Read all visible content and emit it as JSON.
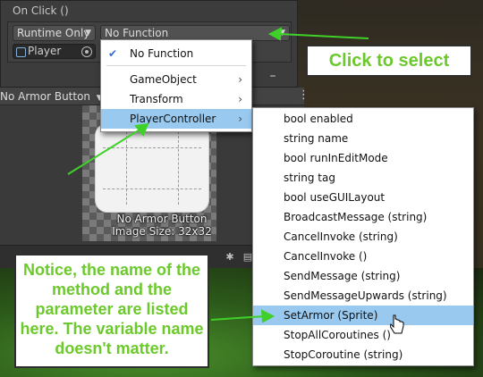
{
  "panel": {
    "title": "On Click ()",
    "runtime_select": "Runtime Only",
    "function_select": "No Function",
    "object_field": "Player",
    "remove_label": "–"
  },
  "preview": {
    "dropdown_label": "No Armor Button",
    "sprite_name": "No Armor Button",
    "image_size": "Image Size: 32x32"
  },
  "menu_primary": {
    "items": [
      {
        "label": "No Function",
        "checked": true
      },
      {
        "label": "GameObject",
        "submenu": true
      },
      {
        "label": "Transform",
        "submenu": true
      },
      {
        "label": "PlayerController",
        "submenu": true,
        "highlighted": true
      }
    ]
  },
  "menu_methods": {
    "items": [
      {
        "label": "bool enabled"
      },
      {
        "label": "string name"
      },
      {
        "label": "bool runInEditMode"
      },
      {
        "label": "string tag"
      },
      {
        "label": "bool useGUILayout"
      },
      {
        "label": "BroadcastMessage (string)"
      },
      {
        "label": "CancelInvoke (string)"
      },
      {
        "label": "CancelInvoke ()"
      },
      {
        "label": "SendMessage (string)"
      },
      {
        "label": "SendMessageUpwards (string)"
      },
      {
        "label": "SetArmor (Sprite)",
        "highlighted": true
      },
      {
        "label": "StopAllCoroutines ()"
      },
      {
        "label": "StopCoroutine (string)"
      }
    ]
  },
  "callouts": {
    "click_to_select": "Click to select",
    "notice_text": "Notice, the name of the method and the parameter are listed here. The variable name doesn't matter."
  },
  "colors": {
    "callout_text": "#6cc92c",
    "arrow": "#3fd12a",
    "menu_highlight": "#99c9ef",
    "check": "#2b6fd6"
  },
  "icons": [
    "dropdown-caret-icon",
    "object-cube-icon",
    "object-picker-icon",
    "kebab-menu-icon",
    "checkmark-icon",
    "chevron-right-icon",
    "mouse-pointer-icon",
    "arrow-annotation-icon"
  ]
}
